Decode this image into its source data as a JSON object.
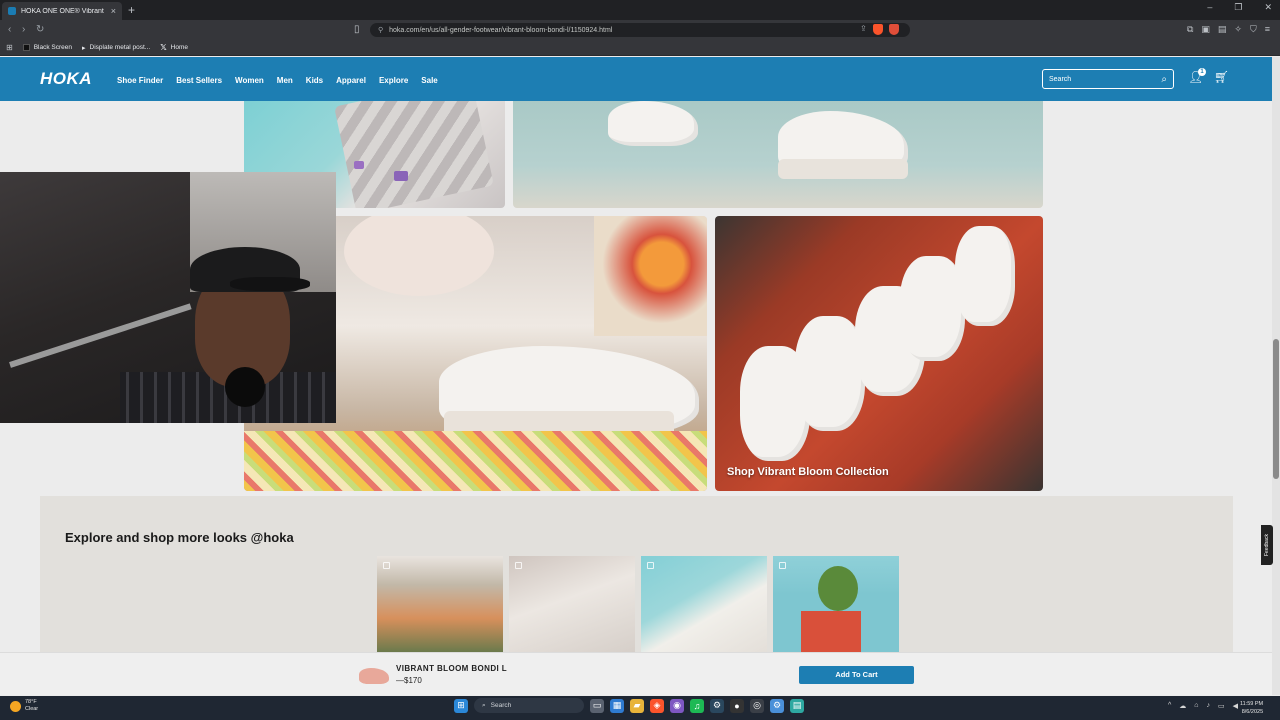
{
  "browser": {
    "tab_title": "HOKA ONE ONE® Vibrant Bloo",
    "url": "hoka.com/en/us/all-gender-footwear/vibrant-bloom-bondi-l/1150924.html",
    "bookmarks": [
      "Black Screen",
      "Displate metal post...",
      "Home"
    ]
  },
  "header": {
    "logo": "HOKA",
    "nav": [
      "Shoe Finder",
      "Best Sellers",
      "Women",
      "Men",
      "Kids",
      "Apparel",
      "Explore",
      "Sale"
    ],
    "search_placeholder": "Search",
    "account_badge": "1"
  },
  "gallery": {
    "collection_link": "Shop Vibrant Bloom Collection"
  },
  "explore": {
    "title": "Explore and shop more looks @hoka"
  },
  "sticky_bar": {
    "product_name": "VIBRANT BLOOM BONDI L",
    "price": "—$170",
    "button": "Add To Cart"
  },
  "side": {
    "feedback": "Feedback"
  },
  "taskbar": {
    "temp": "78°F",
    "condition": "Clear",
    "search": "Search",
    "time": "11:59 PM",
    "date": "8/6/2025"
  },
  "colors": {
    "brand_blue": "#1d7eb3",
    "page_bg": "#ececec",
    "explore_bg": "#e2e0dc"
  }
}
